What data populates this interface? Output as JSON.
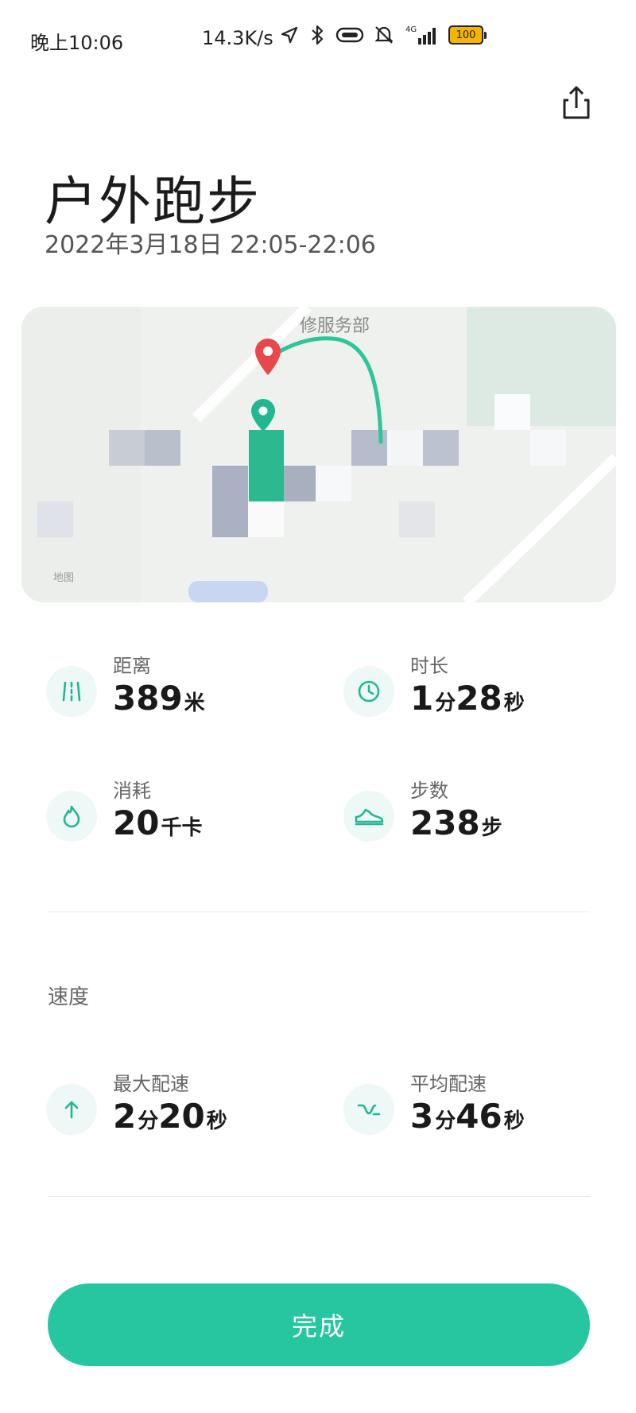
{
  "status_bar": {
    "time": "晚上10:06",
    "net_speed": "14.3K/s",
    "battery": "100",
    "signal": "4G"
  },
  "header": {
    "title": "户外跑步",
    "datetime": "2022年3月18日 22:05-22:06"
  },
  "map": {
    "label": "修服务部",
    "watermark": "地图"
  },
  "stats": {
    "distance": {
      "label": "距离",
      "value": "389",
      "unit": "米"
    },
    "duration": {
      "label": "时长",
      "min": "1",
      "min_unit": "分",
      "sec": "28",
      "sec_unit": "秒"
    },
    "calories": {
      "label": "消耗",
      "value": "20",
      "unit": "千卡"
    },
    "steps": {
      "label": "步数",
      "value": "238",
      "unit": "步"
    }
  },
  "speed": {
    "section_title": "速度",
    "max_pace": {
      "label": "最大配速",
      "min": "2",
      "min_unit": "分",
      "sec": "20",
      "sec_unit": "秒"
    },
    "avg_pace": {
      "label": "平均配速",
      "min": "3",
      "min_unit": "分",
      "sec": "46",
      "sec_unit": "秒"
    }
  },
  "footer": {
    "done_label": "完成"
  },
  "colors": {
    "accent": "#26c6a0",
    "start_pin": "#21b891",
    "end_pin": "#e9474a"
  }
}
